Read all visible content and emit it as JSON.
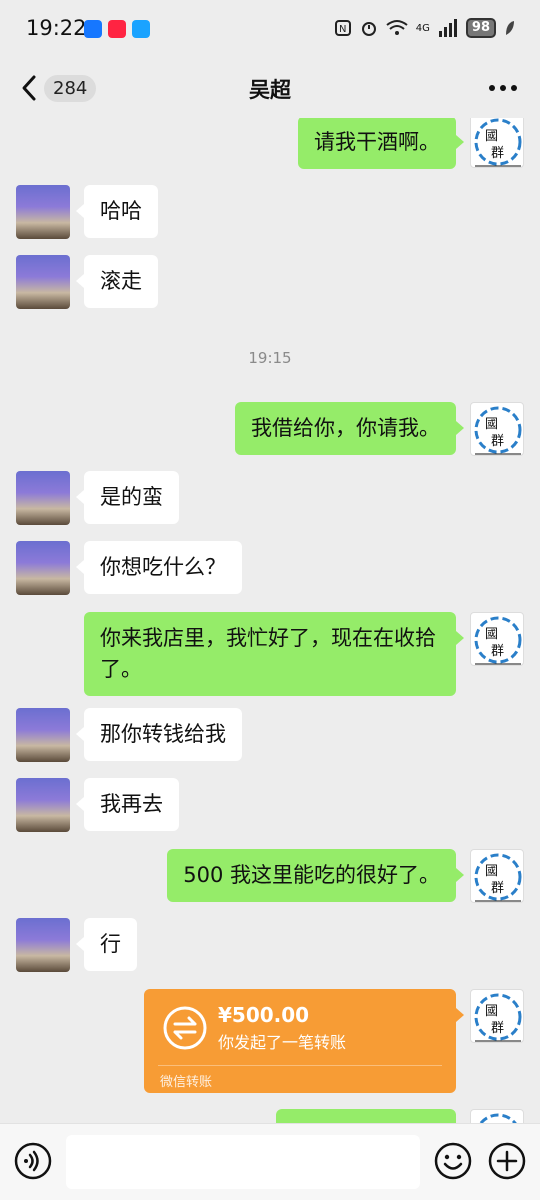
{
  "status_bar": {
    "time": "19:22",
    "app_icons": [
      "alipay-icon",
      "red-app-icon",
      "blue-app-icon"
    ],
    "battery": "98",
    "network": "4G"
  },
  "header": {
    "back_icon": "chevron-left-icon",
    "unread_count": "284",
    "title": "吴超",
    "more_icon": "more-dots-icon"
  },
  "messages": [
    {
      "side": "right",
      "text": "请我干酒啊。"
    },
    {
      "side": "left",
      "text": "哈哈"
    },
    {
      "side": "left",
      "text": "滚走"
    },
    {
      "type": "time",
      "text": "19:15"
    },
    {
      "side": "right",
      "text": "我借给你，你请我。"
    },
    {
      "side": "left",
      "text": "是的蛮"
    },
    {
      "side": "left",
      "text": "你想吃什么？"
    },
    {
      "side": "right",
      "text": "你来我店里，我忙好了，现在在收拾了。"
    },
    {
      "side": "left",
      "text": "那你转钱给我"
    },
    {
      "side": "left",
      "text": "我再去"
    },
    {
      "side": "right",
      "text": "500 我这里能吃的很好了。"
    },
    {
      "side": "left",
      "text": "行"
    },
    {
      "side": "right",
      "type": "transfer",
      "amount": "¥500.00",
      "desc": "你发起了一笔转账",
      "source": "微信转账"
    }
  ],
  "input_bar": {
    "voice_icon": "voice-icon",
    "placeholder": "",
    "emoji_icon": "emoji-icon",
    "plus_icon": "plus-icon"
  },
  "colors": {
    "background": "#ededed",
    "my_bubble": "#95ec69",
    "their_bubble": "#ffffff",
    "transfer_card": "#f79c35"
  }
}
